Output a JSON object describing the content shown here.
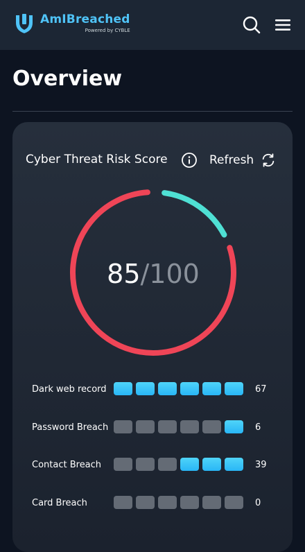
{
  "header": {
    "brand": "AmIBreached",
    "powered_by": "Powered by CYBLE",
    "search_icon": "search-icon",
    "menu_icon": "hamburger-menu-icon",
    "colors": {
      "brand": "#4fc3f7",
      "header_bg": "#1c2634"
    }
  },
  "page": {
    "title": "Overview"
  },
  "risk_card": {
    "title": "Cyber Threat Risk Score",
    "info_icon": "info-icon",
    "refresh_label": "Refresh",
    "refresh_icon": "refresh-icon",
    "score": "85",
    "score_max": "/100",
    "gauge": {
      "value": 85,
      "max": 100,
      "colors": {
        "risk": "#ef4557",
        "safe": "#4fe0d4"
      }
    }
  },
  "metrics": [
    {
      "label": "Dark web record",
      "count": "67",
      "level": 6,
      "total": 6
    },
    {
      "label": "Password Breach",
      "count": "6",
      "level": 1,
      "total": 6
    },
    {
      "label": "Contact Breach",
      "count": "39",
      "level": 3,
      "total": 6
    },
    {
      "label": "Card Breach",
      "count": "0",
      "level": 0,
      "total": 6
    }
  ],
  "colors": {
    "bar_on": "#33c3f7",
    "bar_off": "#646b75",
    "background": "#0d1421"
  }
}
